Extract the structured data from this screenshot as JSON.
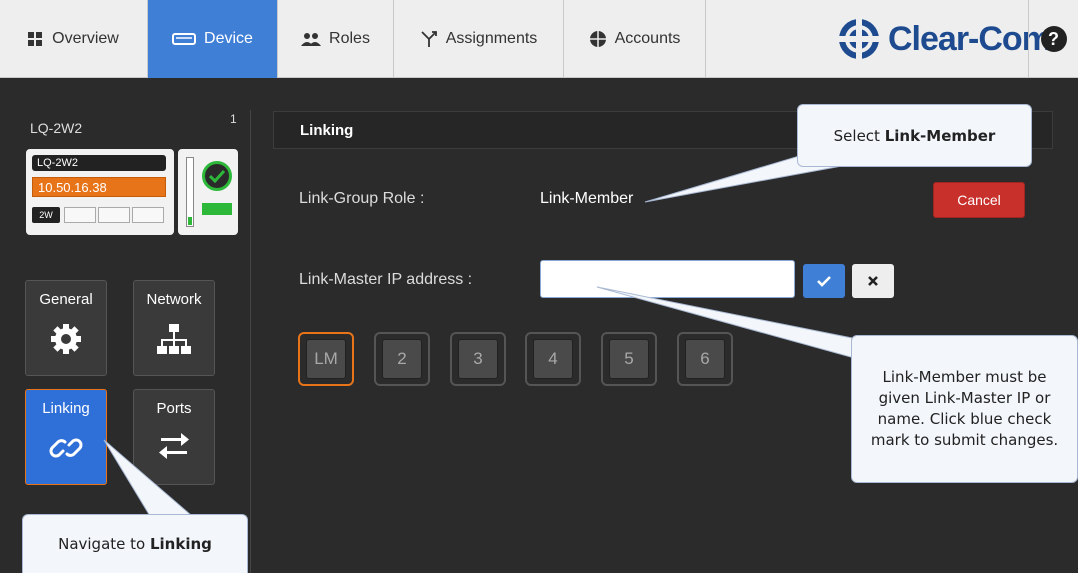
{
  "nav": {
    "tabs": [
      {
        "label": "Overview",
        "icon": "overview-grid-icon"
      },
      {
        "label": "Device",
        "icon": "device-icon",
        "active": true
      },
      {
        "label": "Roles",
        "icon": "roles-people-icon"
      },
      {
        "label": "Assignments",
        "icon": "assignments-fork-icon"
      },
      {
        "label": "Accounts",
        "icon": "accounts-globe-icon"
      }
    ],
    "logo_text": "Clear-Com",
    "help_label": "?"
  },
  "device": {
    "name": "LQ-2W2",
    "slot_number": "1",
    "card_label": "LQ-2W2",
    "ip": "10.50.16.38",
    "type_badge": "2W",
    "status": "online"
  },
  "tiles": [
    {
      "label": "General",
      "icon": "gear-icon"
    },
    {
      "label": "Network",
      "icon": "network-icon"
    },
    {
      "label": "Linking",
      "icon": "link-icon",
      "active": true
    },
    {
      "label": "Ports",
      "icon": "swap-arrows-icon"
    }
  ],
  "panel": {
    "title": "Linking",
    "role_label": "Link-Group Role :",
    "role_value": "Link-Member",
    "cancel_label": "Cancel",
    "master_ip_label": "Link-Master IP address :",
    "master_ip_value": "",
    "master_ip_placeholder": "",
    "link_buttons": [
      "LM",
      "2",
      "3",
      "4",
      "5",
      "6"
    ]
  },
  "callouts": {
    "select_prefix": "Select ",
    "select_bold": "Link-Member",
    "member_help": "Link-Member must be given Link-Master IP or name. Click blue check mark to submit changes.",
    "navigate_prefix": "Navigate to ",
    "navigate_bold": "Linking"
  },
  "colors": {
    "accent_blue": "#3f7fd6",
    "cancel_red": "#c8302c",
    "ip_orange": "#e8741a",
    "status_green": "#2db83a",
    "logo_blue": "#1e4b8f"
  }
}
